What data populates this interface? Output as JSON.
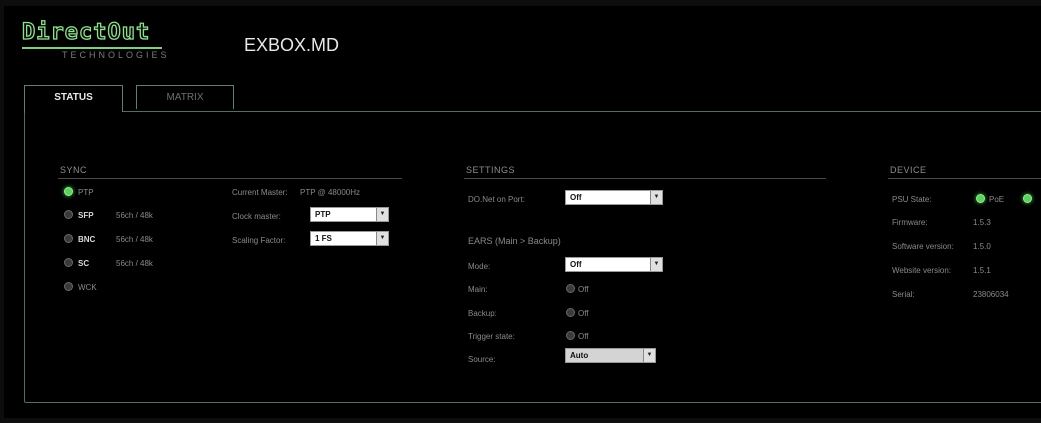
{
  "header": {
    "logo_main": "DirectOut",
    "logo_sub": "TECHNOLOGIES",
    "device_name": "EXBOX.MD"
  },
  "tabs": [
    {
      "label": "STATUS",
      "active": true
    },
    {
      "label": "MATRIX",
      "active": false
    }
  ],
  "sync": {
    "title": "SYNC",
    "sources": [
      {
        "label": "PTP",
        "detail": "",
        "active": true
      },
      {
        "label": "SFP",
        "detail": "56ch / 48k",
        "active": false
      },
      {
        "label": "BNC",
        "detail": "56ch / 48k",
        "active": false
      },
      {
        "label": "SC",
        "detail": "56ch / 48k",
        "active": false
      },
      {
        "label": "WCK",
        "detail": "",
        "active": false
      }
    ],
    "current_master_label": "Current Master:",
    "current_master_value": "PTP @ 48000Hz",
    "clock_master_label": "Clock master:",
    "clock_master_value": "PTP",
    "scaling_factor_label": "Scaling Factor:",
    "scaling_factor_value": "1 FS"
  },
  "settings": {
    "title": "SETTINGS",
    "donet_label": "DO.Net on Port:",
    "donet_value": "Off",
    "ears_title": "EARS (Main > Backup)",
    "mode_label": "Mode:",
    "mode_value": "Off",
    "main_label": "Main:",
    "main_value": "Off",
    "backup_label": "Backup:",
    "backup_value": "Off",
    "trigger_label": "Trigger state:",
    "trigger_value": "Off",
    "source_label": "Source:",
    "source_value": "Auto"
  },
  "device": {
    "title": "DEVICE",
    "psu_label": "PSU State:",
    "psu_option_1": "PoE",
    "firmware_label": "Firmware:",
    "firmware_value": "1.5.3",
    "software_label": "Software version:",
    "software_value": "1.5.0",
    "website_label": "Website version:",
    "website_value": "1.5.1",
    "serial_label": "Serial:",
    "serial_value": "23806034"
  },
  "colors": {
    "accent_green": "#5fd05f",
    "panel_border": "#4f6f63",
    "background": "#000000"
  }
}
